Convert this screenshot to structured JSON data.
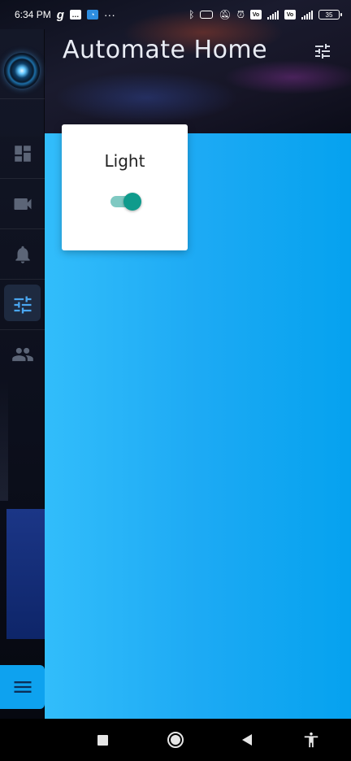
{
  "status_bar": {
    "time": "6:34 PM",
    "left_icons": [
      "g-icon",
      "message-icon",
      "speed-icon",
      "more-dots"
    ],
    "more_dots": "···",
    "volte_label_1": "Vo",
    "volte_label_2": "Vo",
    "battery": "35"
  },
  "header": {
    "title": "Automate Home",
    "settings_icon": "sliders-icon"
  },
  "sidebar": {
    "items": [
      {
        "name": "dashboard",
        "icon": "dashboard-icon",
        "active": false
      },
      {
        "name": "camera",
        "icon": "videocam-icon",
        "active": false
      },
      {
        "name": "notifications",
        "icon": "bell-icon",
        "active": false
      },
      {
        "name": "controls",
        "icon": "sliders-icon",
        "active": true
      },
      {
        "name": "users",
        "icon": "people-icon",
        "active": false
      }
    ],
    "menu_icon": "hamburger-icon"
  },
  "card": {
    "title": "Light",
    "switch_on": true
  },
  "colors": {
    "accent_blue": "#0ea2ef",
    "switch_thumb": "#0f9b8c",
    "switch_track": "#7fc9c2",
    "active_icon": "#4aa6f0",
    "inactive_icon": "#5c6577"
  },
  "nav_bar": {
    "buttons": [
      "square-icon",
      "home-circle-icon",
      "back-triangle-icon",
      "accessibility-icon"
    ]
  }
}
